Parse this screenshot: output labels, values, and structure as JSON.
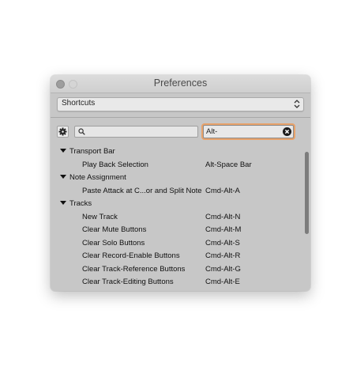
{
  "window": {
    "title": "Preferences"
  },
  "popup": {
    "selected": "Shortcuts",
    "arrows_icon": "up-down-arrows-icon"
  },
  "toolbar": {
    "gear_icon": "gear-icon",
    "search_icon": "magnifier-icon",
    "search_value": "",
    "shortcut_value": "Alt-",
    "clear_icon": "clear-x-icon",
    "focus_color": "#e8a26a"
  },
  "groups": [
    {
      "label": "Transport Bar",
      "items": [
        {
          "label": "Play Back Selection",
          "shortcut": "Alt-Space Bar"
        }
      ]
    },
    {
      "label": "Note Assignment",
      "items": [
        {
          "label": "Paste Attack at C...or and Split Note",
          "shortcut": "Cmd-Alt-A"
        }
      ]
    },
    {
      "label": "Tracks",
      "items": [
        {
          "label": "New Track",
          "shortcut": "Cmd-Alt-N"
        },
        {
          "label": "Clear Mute Buttons",
          "shortcut": "Cmd-Alt-M"
        },
        {
          "label": "Clear Solo Buttons",
          "shortcut": "Cmd-Alt-S"
        },
        {
          "label": "Clear Record-Enable Buttons",
          "shortcut": "Cmd-Alt-R"
        },
        {
          "label": "Clear Track-Reference Buttons",
          "shortcut": "Cmd-Alt-G"
        },
        {
          "label": "Clear Track-Editing Buttons",
          "shortcut": "Cmd-Alt-E"
        }
      ]
    }
  ]
}
